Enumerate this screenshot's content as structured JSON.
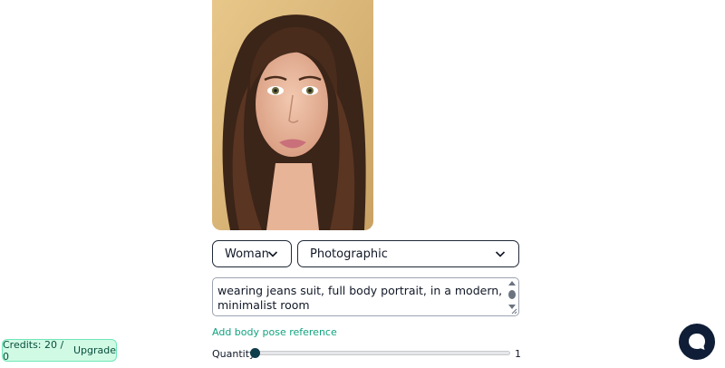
{
  "portrait": {
    "alt": "generated portrait"
  },
  "selectors": {
    "gender_value": "Woman",
    "style_value": "Photographic"
  },
  "prompt": {
    "value": "wearing jeans suit, full body portrait, in a modern, minimalist room"
  },
  "pose_link_label": "Add body pose reference",
  "quantity": {
    "label": "Quantity",
    "value": "1",
    "min": 1
  },
  "credits": {
    "label": "Credits: 20 / 0",
    "upgrade_label": "Upgrade"
  },
  "colors": {
    "accent": "#10a37f",
    "chat_button": "#0f1d36",
    "credits_bg": "#d1fae5"
  },
  "icons": [
    "chevron-down-icon",
    "chat-bubble-icon"
  ]
}
